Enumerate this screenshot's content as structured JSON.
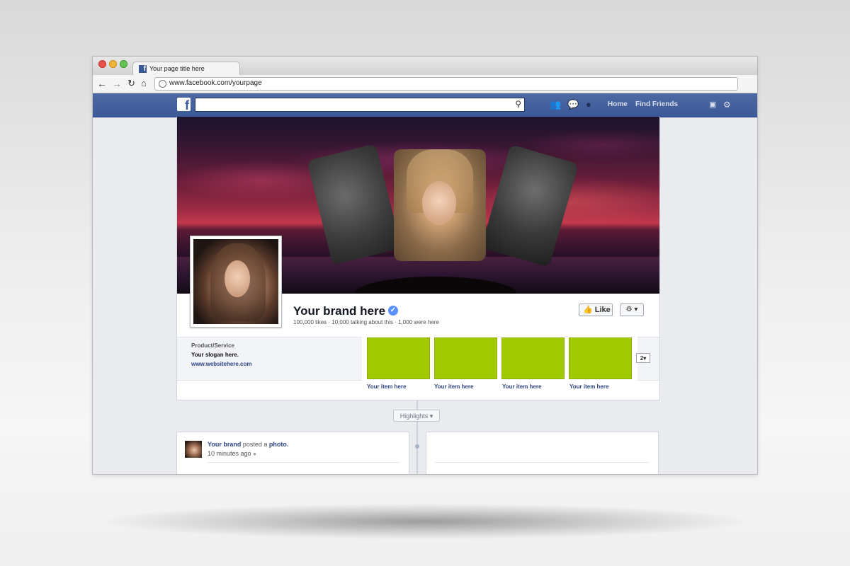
{
  "browser": {
    "tab_title": "Your page title here",
    "url": "www.facebook.com/yourpage"
  },
  "fb_header": {
    "logo_letter": "f",
    "nav_home": "Home",
    "nav_find_friends": "Find Friends"
  },
  "profile": {
    "brand_name": "Your brand here",
    "stats": "100,000 likes · 10,000 talking about this · 1,000 were here",
    "like_label": "Like",
    "category": "Product/Service",
    "slogan": "Your slogan here.",
    "website": "www.websitehere.com",
    "more_count": "2"
  },
  "tiles": [
    {
      "label": "Your item here",
      "color": "#a2c800"
    },
    {
      "label": "Your item here",
      "color": "#a2c800"
    },
    {
      "label": "Your item here",
      "color": "#a2c800"
    },
    {
      "label": "Your item here",
      "color": "#a2c800"
    }
  ],
  "timeline": {
    "highlights_label": "Highlights",
    "post": {
      "author": "Your brand",
      "action": "posted a",
      "object": "photo.",
      "time": "10 minutes ago"
    }
  },
  "colors": {
    "fb_blue": "#3b5998",
    "tile_green": "#a2c800",
    "link_blue": "#2d4486"
  }
}
